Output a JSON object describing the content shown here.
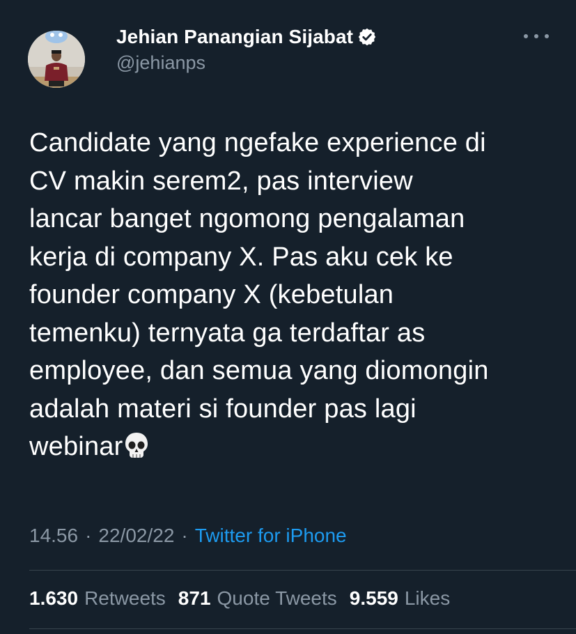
{
  "author": {
    "display_name": "Jehian Panangian Sijabat",
    "handle": "@jehianps",
    "verified": true,
    "avatar_icon": "profile-photo"
  },
  "tweet": {
    "text": "Candidate yang ngefake experience di\nCV makin serem2, pas interview\nlancar banget ngomong pengalaman\nkerja di company X. Pas aku cek ke\nfounder company X (kebetulan\ntemenku) ternyata ga terdaftar as\nemployee, dan semua yang diomongin\nadalah materi si founder pas lagi\nwebinar",
    "emoji_icon": "skull-emoji"
  },
  "meta": {
    "time": "14.56",
    "separator": "·",
    "date": "22/02/22",
    "source": "Twitter for iPhone"
  },
  "stats": {
    "retweets_count": "1.630",
    "retweets_label": "Retweets",
    "quotes_count": "871",
    "quotes_label": "Quote Tweets",
    "likes_count": "9.559",
    "likes_label": "Likes"
  },
  "colors": {
    "background": "#15202b",
    "text": "#ffffff",
    "secondary": "#8b98a5",
    "link": "#1d9bf0",
    "divider": "#38444d"
  }
}
